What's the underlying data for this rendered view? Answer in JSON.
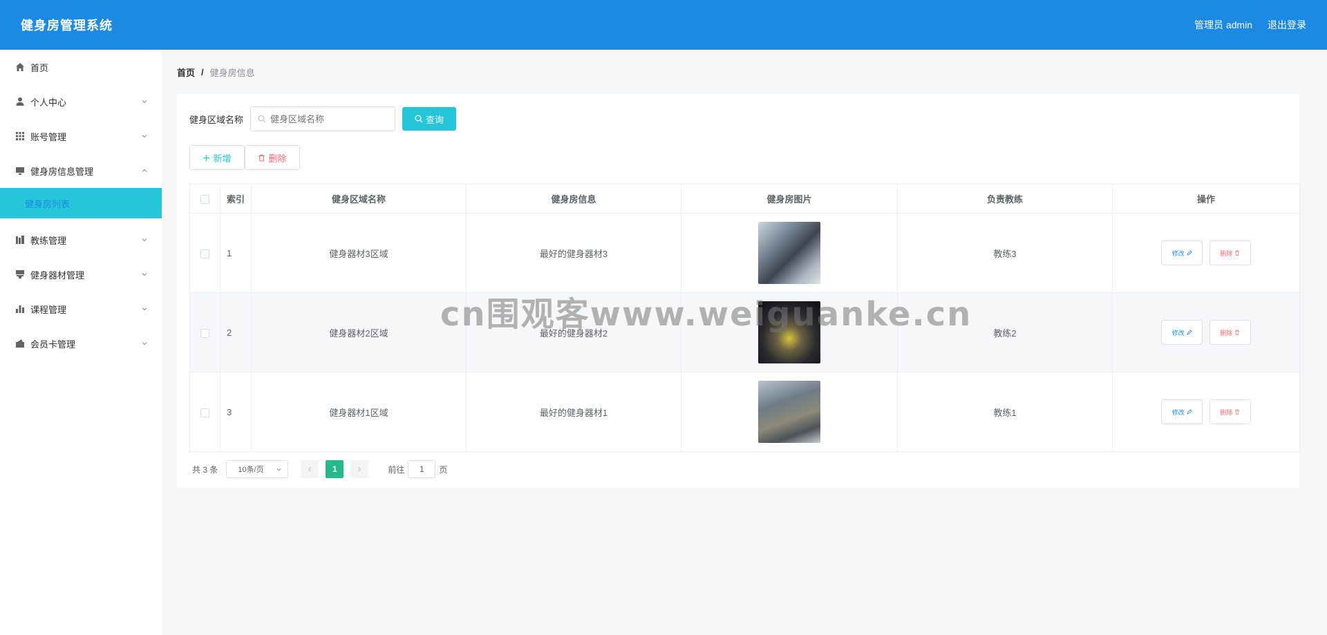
{
  "header": {
    "title": "健身房管理系统",
    "user_label": "管理员 admin",
    "logout_label": "退出登录"
  },
  "sidebar": {
    "items": [
      {
        "label": "首页",
        "icon": "home-icon"
      },
      {
        "label": "个人中心",
        "icon": "user-icon"
      },
      {
        "label": "账号管理",
        "icon": "grid-icon"
      },
      {
        "label": "健身房信息管理",
        "icon": "monitor-icon",
        "expanded": true,
        "children": [
          {
            "label": "健身房列表",
            "active": true
          }
        ]
      },
      {
        "label": "教练管理",
        "icon": "library-icon"
      },
      {
        "label": "健身器材管理",
        "icon": "stamp-icon"
      },
      {
        "label": "课程管理",
        "icon": "bar-chart-icon"
      },
      {
        "label": "会员卡管理",
        "icon": "card-icon"
      }
    ]
  },
  "breadcrumb": {
    "home": "首页",
    "separator": "/",
    "current": "健身房信息"
  },
  "search": {
    "label": "健身区域名称",
    "placeholder": "健身区域名称",
    "value": "",
    "button_label": "查询"
  },
  "actions": {
    "add_label": "新增",
    "delete_label": "删除"
  },
  "table": {
    "columns": [
      "",
      "索引",
      "健身区域名称",
      "健身房信息",
      "健身房图片",
      "负责教练",
      "操作"
    ],
    "rows": [
      {
        "index": "1",
        "area": "健身器材3区域",
        "info": "最好的健身器材3",
        "coach": "教练3"
      },
      {
        "index": "2",
        "area": "健身器材2区域",
        "info": "最好的健身器材2",
        "coach": "教练2"
      },
      {
        "index": "3",
        "area": "健身器材1区域",
        "info": "最好的健身器材1",
        "coach": "教练1"
      }
    ],
    "edit_label": "修改",
    "delete_label": "删除"
  },
  "pagination": {
    "total_text": "共 3 条",
    "page_size": "10条/页",
    "current_page": "1",
    "goto_prefix": "前往",
    "goto_value": "1",
    "goto_suffix": "页"
  },
  "watermark": "cn围观客www.weiguanke.cn",
  "colors": {
    "header": "#1c8ae3",
    "accent": "#26c6da",
    "pager_active": "#26b98a",
    "danger": "#f56c6c"
  }
}
